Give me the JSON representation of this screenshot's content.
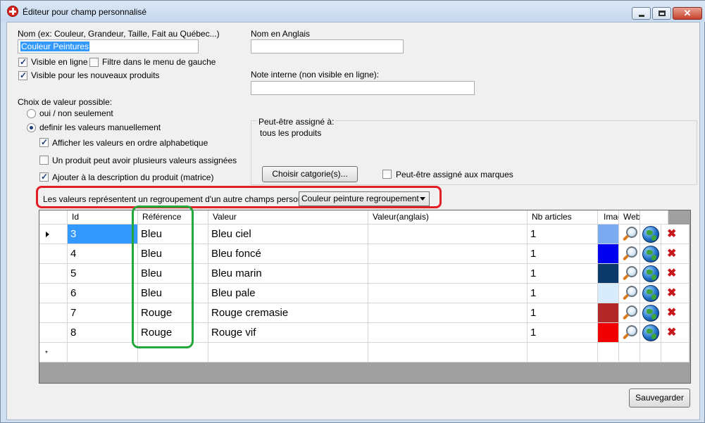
{
  "window": {
    "title": "Éditeur pour champ personnalisé",
    "close_glyph": "✕"
  },
  "form": {
    "name_label": "Nom (ex: Couleur, Grandeur, Taille, Fait au Québec...)",
    "name_value": "Couleur Peintures",
    "english_name_label": "Nom en Anglais",
    "english_name_value": "",
    "visible_online_label": "Visible en ligne",
    "visible_online_checked": true,
    "filter_left_menu_label": "Filtre dans le menu de gauche",
    "filter_left_menu_checked": false,
    "visible_new_products_label": "Visible pour les nouveaux produits",
    "visible_new_products_checked": true,
    "internal_note_label": "Note interne (non visible en ligne):",
    "internal_note_value": "",
    "value_choice_label": "Choix de valeur possible:",
    "radio_yes_no_label": "oui / non seulement",
    "radio_manual_label": "definir les valeurs manuellement",
    "selected_radio": "manual",
    "sort_alpha_label": "Afficher les valeurs en ordre alphabetique",
    "sort_alpha_checked": true,
    "multi_values_label": "Un produit peut avoir plusieurs valeurs assignées",
    "multi_values_checked": false,
    "add_description_label": "Ajouter à la description du produit (matrice)",
    "add_description_checked": true,
    "assignable_label": "Peut-être assigné à:",
    "assignable_value": "tous les produits",
    "choose_category_button": "Choisir catgorie(s)...",
    "assign_brands_label": "Peut-être assigné aux marques",
    "assign_brands_checked": false,
    "grouping_label": "Les valeurs représentent un regroupement d'un autre champs personnalisé:",
    "grouping_select_value": "Couleur peinture regroupement",
    "save_button": "Sauvegarder"
  },
  "grid": {
    "columns": [
      "Id",
      "Référence",
      "Valeur",
      "Valeur(anglais)",
      "Nb articles",
      "Imag",
      "Web",
      ""
    ],
    "rows": [
      {
        "id": "3",
        "reference": "Bleu",
        "value": "Bleu ciel",
        "value_en": "",
        "count": "1",
        "color": "#7aaaf0"
      },
      {
        "id": "4",
        "reference": "Bleu",
        "value": "Bleu foncé",
        "value_en": "",
        "count": "1",
        "color": "#0000f0"
      },
      {
        "id": "5",
        "reference": "Bleu",
        "value": "Bleu marin",
        "value_en": "",
        "count": "1",
        "color": "#0b3a6b"
      },
      {
        "id": "6",
        "reference": "Bleu",
        "value": "Bleu pale",
        "value_en": "",
        "count": "1",
        "color": "#d9ecfb"
      },
      {
        "id": "7",
        "reference": "Rouge",
        "value": "Rouge cremasie",
        "value_en": "",
        "count": "1",
        "color": "#b22828"
      },
      {
        "id": "8",
        "reference": "Rouge",
        "value": "Rouge vif",
        "value_en": "",
        "count": "1",
        "color": "#f00000"
      }
    ],
    "selected_row_id": "3",
    "new_row_marker": "*",
    "delete_glyph": "✖"
  },
  "icons": {
    "image_cell": "magnifier-icon",
    "web_cell": "globe-icon",
    "delete_cell": "delete-x-icon",
    "app": "app-logo-icon"
  }
}
